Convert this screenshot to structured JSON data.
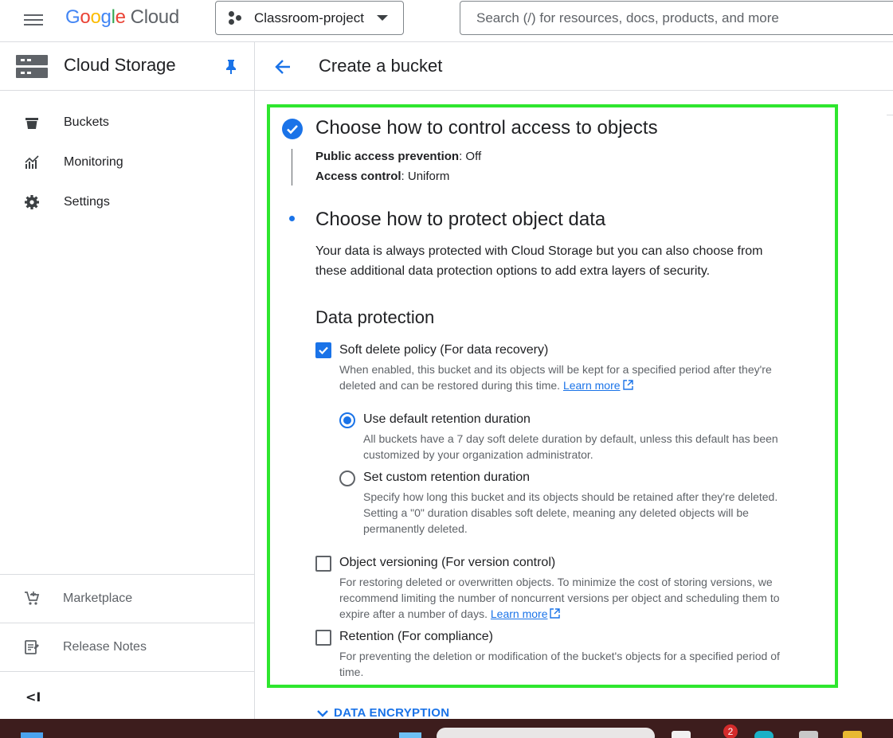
{
  "topbar": {
    "logo_google": [
      "G",
      "o",
      "o",
      "g",
      "l",
      "e"
    ],
    "logo_cloud": "Cloud",
    "project_name": "Classroom-project",
    "search_placeholder": "Search (/) for resources, docs, products, and more"
  },
  "sidebar": {
    "title": "Cloud Storage",
    "items": [
      {
        "label": "Buckets",
        "icon": "bucket-icon"
      },
      {
        "label": "Monitoring",
        "icon": "monitoring-icon"
      },
      {
        "label": "Settings",
        "icon": "gear-icon"
      }
    ],
    "bottom_items": [
      {
        "label": "Marketplace",
        "icon": "marketplace-cart-icon"
      },
      {
        "label": "Release Notes",
        "icon": "release-notes-icon"
      }
    ],
    "collapse_glyph": "<I"
  },
  "main": {
    "page_title": "Create a bucket",
    "step1": {
      "title": "Choose how to control access to objects",
      "summary": [
        {
          "key": "Public access prevention",
          "value": ": Off"
        },
        {
          "key": "Access control",
          "value": ": Uniform"
        }
      ]
    },
    "step2": {
      "title": "Choose how to protect object data",
      "description": "Your data is always protected with Cloud Storage but you can also choose from these additional data protection options to add extra layers of security.",
      "section_heading": "Data protection",
      "soft_delete": {
        "label": "Soft delete policy (For data recovery)",
        "checked": true,
        "description": "When enabled, this bucket and its objects will be kept for a specified period after they're deleted and can be restored during this time.",
        "link": "Learn more"
      },
      "retention_options": [
        {
          "label": "Use default retention duration",
          "selected": true,
          "description": "All buckets have a 7 day soft delete duration by default, unless this default has been customized by your organization administrator."
        },
        {
          "label": "Set custom retention duration",
          "selected": false,
          "description": "Specify how long this bucket and its objects should be retained after they're deleted. Setting a \"0\" duration disables soft delete, meaning any deleted objects will be permanently deleted."
        }
      ],
      "versioning": {
        "label": "Object versioning (For version control)",
        "checked": false,
        "description": "For restoring deleted or overwritten objects. To minimize the cost of storing versions, we recommend limiting the number of noncurrent versions per object and scheduling them to expire after a number of days.",
        "link": "Learn more"
      },
      "retention": {
        "label": "Retention (For compliance)",
        "checked": false,
        "description": "For preventing the deletion or modification of the bucket's objects for a specified period of time."
      }
    },
    "data_encryption_label": "DATA ENCRYPTION"
  },
  "taskbar": {
    "notification_badge": "2"
  },
  "colors": {
    "accent": "#1a73e8",
    "highlight_border": "#2ee62e"
  }
}
